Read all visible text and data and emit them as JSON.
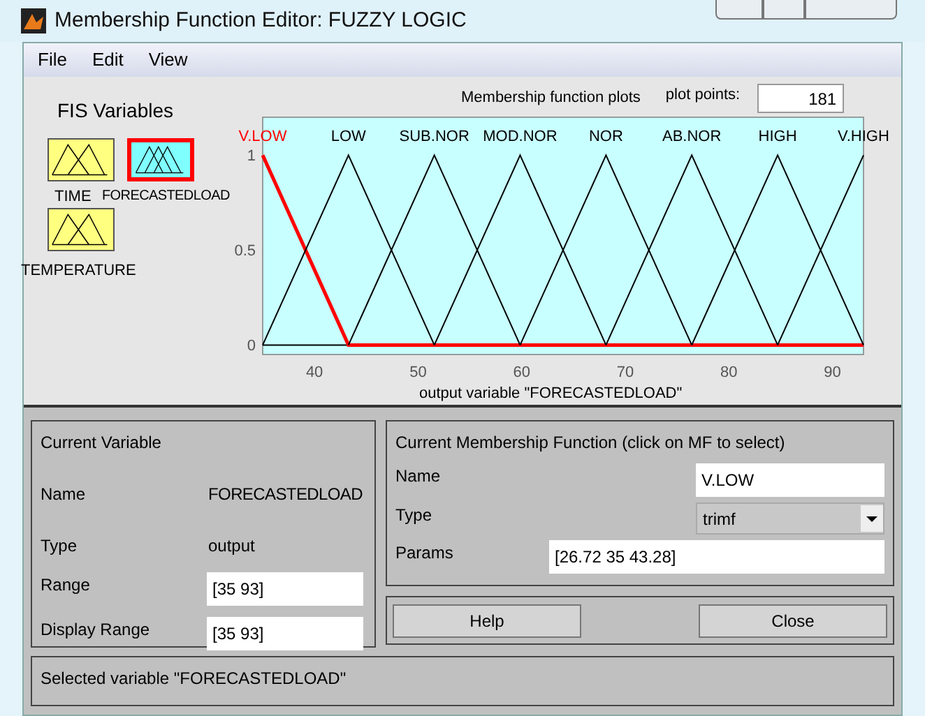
{
  "window": {
    "title": "Membership Function Editor: FUZZY LOGIC"
  },
  "menu": [
    "File",
    "Edit",
    "View"
  ],
  "fis_variables": {
    "title": "FIS Variables",
    "items": [
      {
        "name": "TIME",
        "kind": "input",
        "selected": false
      },
      {
        "name": "FORECASTEDLOAD",
        "kind": "output",
        "selected": true
      },
      {
        "name": "TEMPERATURE",
        "kind": "input",
        "selected": false
      }
    ]
  },
  "plot": {
    "title": "Membership function plots",
    "plot_points_label": "plot points:",
    "plot_points": "181",
    "chart_data": {
      "type": "line",
      "xlabel": "output variable \"FORECASTEDLOAD\"",
      "x": [
        35,
        43.28,
        51.57,
        59.85,
        68.14,
        76.42,
        84.71,
        93
      ],
      "xlim": [
        35,
        93
      ],
      "ylim": [
        -0.05,
        1.2
      ],
      "xticks": [
        40,
        50,
        60,
        70,
        80,
        90
      ],
      "yticks": [
        0,
        0.5,
        1
      ],
      "series": [
        {
          "name": "V.LOW",
          "color": "#ff0000",
          "values": [
            1,
            0,
            0,
            0,
            0,
            0,
            0,
            0
          ]
        },
        {
          "name": "LOW",
          "color": "#000000",
          "values": [
            0,
            1,
            0,
            null,
            null,
            null,
            null,
            null
          ]
        },
        {
          "name": "SUB.NOR",
          "color": "#000000",
          "values": [
            null,
            0,
            1,
            0,
            null,
            null,
            null,
            null
          ]
        },
        {
          "name": "MOD.NOR",
          "color": "#000000",
          "values": [
            null,
            null,
            0,
            1,
            0,
            null,
            null,
            null
          ]
        },
        {
          "name": "NOR",
          "color": "#000000",
          "values": [
            null,
            null,
            null,
            0,
            1,
            0,
            null,
            null
          ]
        },
        {
          "name": "AB.NOR",
          "color": "#000000",
          "values": [
            null,
            null,
            null,
            null,
            0,
            1,
            0,
            null
          ]
        },
        {
          "name": "HIGH",
          "color": "#000000",
          "values": [
            null,
            null,
            null,
            null,
            null,
            0,
            1,
            0
          ]
        },
        {
          "name": "V.HIGH",
          "color": "#000000",
          "values": [
            null,
            null,
            null,
            null,
            null,
            null,
            0,
            1
          ]
        }
      ]
    }
  },
  "current_variable": {
    "title": "Current Variable",
    "name_label": "Name",
    "name": "FORECASTEDLOAD",
    "type_label": "Type",
    "type": "output",
    "range_label": "Range",
    "range": "[35 93]",
    "display_range_label": "Display Range",
    "display_range": "[35 93]"
  },
  "current_mf": {
    "title": "Current Membership Function (click on MF to select)",
    "name_label": "Name",
    "name": "V.LOW",
    "type_label": "Type",
    "type": "trimf",
    "params_label": "Params",
    "params": "[26.72 35 43.28]"
  },
  "buttons": [
    "Help",
    "Close"
  ],
  "status_bar": "Selected variable \"FORECASTEDLOAD\""
}
